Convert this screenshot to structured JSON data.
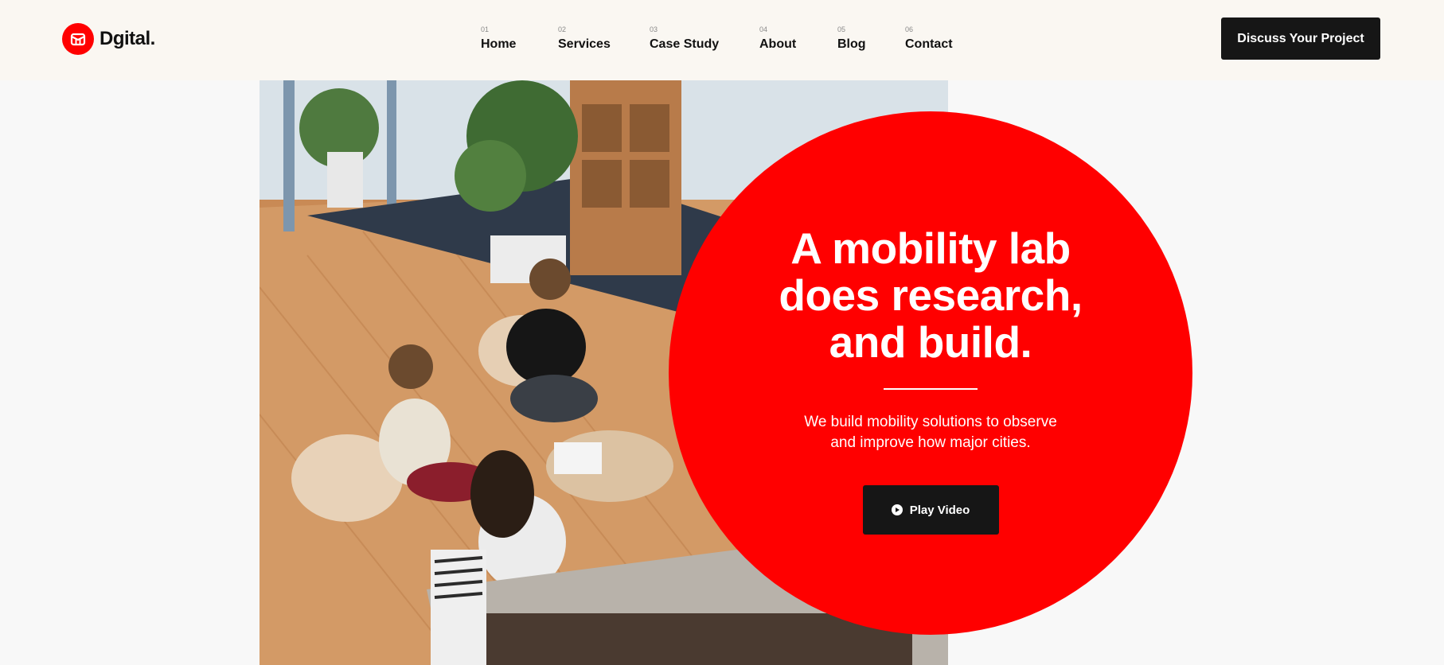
{
  "brand": {
    "name": "Dgital.",
    "accent": "#ff0000",
    "dark": "#161616"
  },
  "nav": [
    {
      "num": "01",
      "label": "Home"
    },
    {
      "num": "02",
      "label": "Services"
    },
    {
      "num": "03",
      "label": "Case Study"
    },
    {
      "num": "04",
      "label": "About"
    },
    {
      "num": "05",
      "label": "Blog"
    },
    {
      "num": "06",
      "label": "Contact"
    }
  ],
  "header": {
    "cta_label": "Discuss Your Project"
  },
  "hero": {
    "title_lines": [
      "A mobility lab",
      "does research,",
      "and build."
    ],
    "subtitle_lines": [
      "We build mobility solutions to observe",
      "and improve how major cities."
    ],
    "play_label": "Play Video",
    "icons": {
      "logo": "logo-mark-icon",
      "play": "play-icon"
    }
  }
}
